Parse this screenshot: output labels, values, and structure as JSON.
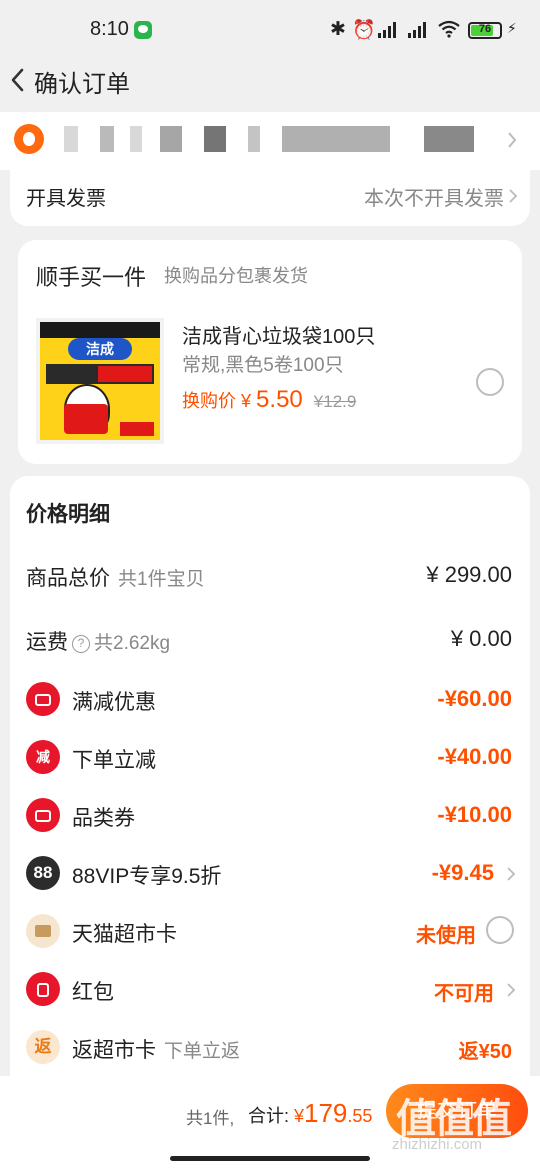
{
  "status_bar": {
    "time": "8:10",
    "battery": "76"
  },
  "nav": {
    "title": "确认订单"
  },
  "invoice": {
    "label": "开具发票",
    "value": "本次不开具发票"
  },
  "addon": {
    "title": "顺手买一件",
    "subtitle": "换购品分包裹发货",
    "product": {
      "name": "洁成背心垃圾袋100只",
      "spec": "常规,黑色5卷100只",
      "price_label": "换购价",
      "currency": "¥",
      "price": "5.50",
      "orig_price": "¥12.9",
      "image_brand": "洁成"
    }
  },
  "price_detail": {
    "title": "价格明细",
    "rows": [
      {
        "label": "商品总价",
        "note": "共1件宝贝",
        "amount": "¥ 299.00"
      },
      {
        "label": "运费",
        "note": "共2.62kg",
        "amount": "¥ 0.00"
      },
      {
        "label": "满减优惠",
        "amount": "-¥60.00",
        "icon": "ticket-icon"
      },
      {
        "label": "下单立减",
        "amount": "-¥40.00",
        "icon": "reduce-icon",
        "icon_text": "减"
      },
      {
        "label": "品类券",
        "amount": "-¥10.00",
        "icon": "coupon-icon"
      },
      {
        "label": "88VIP专享9.5折",
        "amount": "-¥9.45",
        "icon": "vip-88-icon",
        "icon_text": "88"
      },
      {
        "label": "天猫超市卡",
        "amount": "未使用",
        "icon": "card-icon"
      },
      {
        "label": "红包",
        "amount": "不可用",
        "icon": "red-packet-icon"
      },
      {
        "label": "返超市卡",
        "note": "下单立返",
        "amount": "返¥50",
        "icon": "rebate-icon",
        "icon_text": "返"
      }
    ]
  },
  "footer": {
    "count": "共1件,",
    "total_label": "合计:",
    "currency": "¥",
    "total_int": "179",
    "total_dec": ".55",
    "submit": "提交订单"
  },
  "watermark": {
    "text": "值值值",
    "site": "zhizhizhi.com"
  },
  "colors": {
    "accent": "#ff5000",
    "icon_red": "#e8162a",
    "bg": "#f0f0f0"
  }
}
